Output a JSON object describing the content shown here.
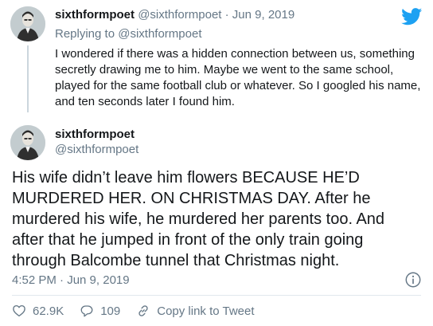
{
  "reply": {
    "name": "sixthformpoet",
    "handle": "@sixthformpoet",
    "separator": "·",
    "date": "Jun 9, 2019",
    "replying_label": "Replying to",
    "replying_handle": "@sixthformpoet",
    "text": "I wondered if there was a hidden connection between us, something secretly drawing me to him. Maybe we went to the same school, played for the same football club or whatever. So I googled his name, and ten seconds later I found him."
  },
  "main": {
    "name": "sixthformpoet",
    "handle": "@sixthformpoet",
    "text": "His wife didn’t leave him flowers BECAUSE HE’D MURDERED HER. ON CHRISTMAS DAY. After he murdered his wife, he murdered her parents too. And after that he jumped in front of the only train going through Balcombe tunnel that Christmas night.",
    "timestamp": "4:52 PM · Jun 9, 2019"
  },
  "actions": {
    "likes": "62.9K",
    "replies": "109",
    "copy_label": "Copy link to Tweet"
  },
  "icons": {
    "logo": "twitter-bird-icon",
    "info": "info-icon",
    "like": "heart-icon",
    "reply": "speech-bubble-icon",
    "copy": "link-icon"
  },
  "colors": {
    "brand": "#1da1f2",
    "text": "#14171a",
    "muted": "#657786",
    "divider": "#e1e8ed"
  }
}
